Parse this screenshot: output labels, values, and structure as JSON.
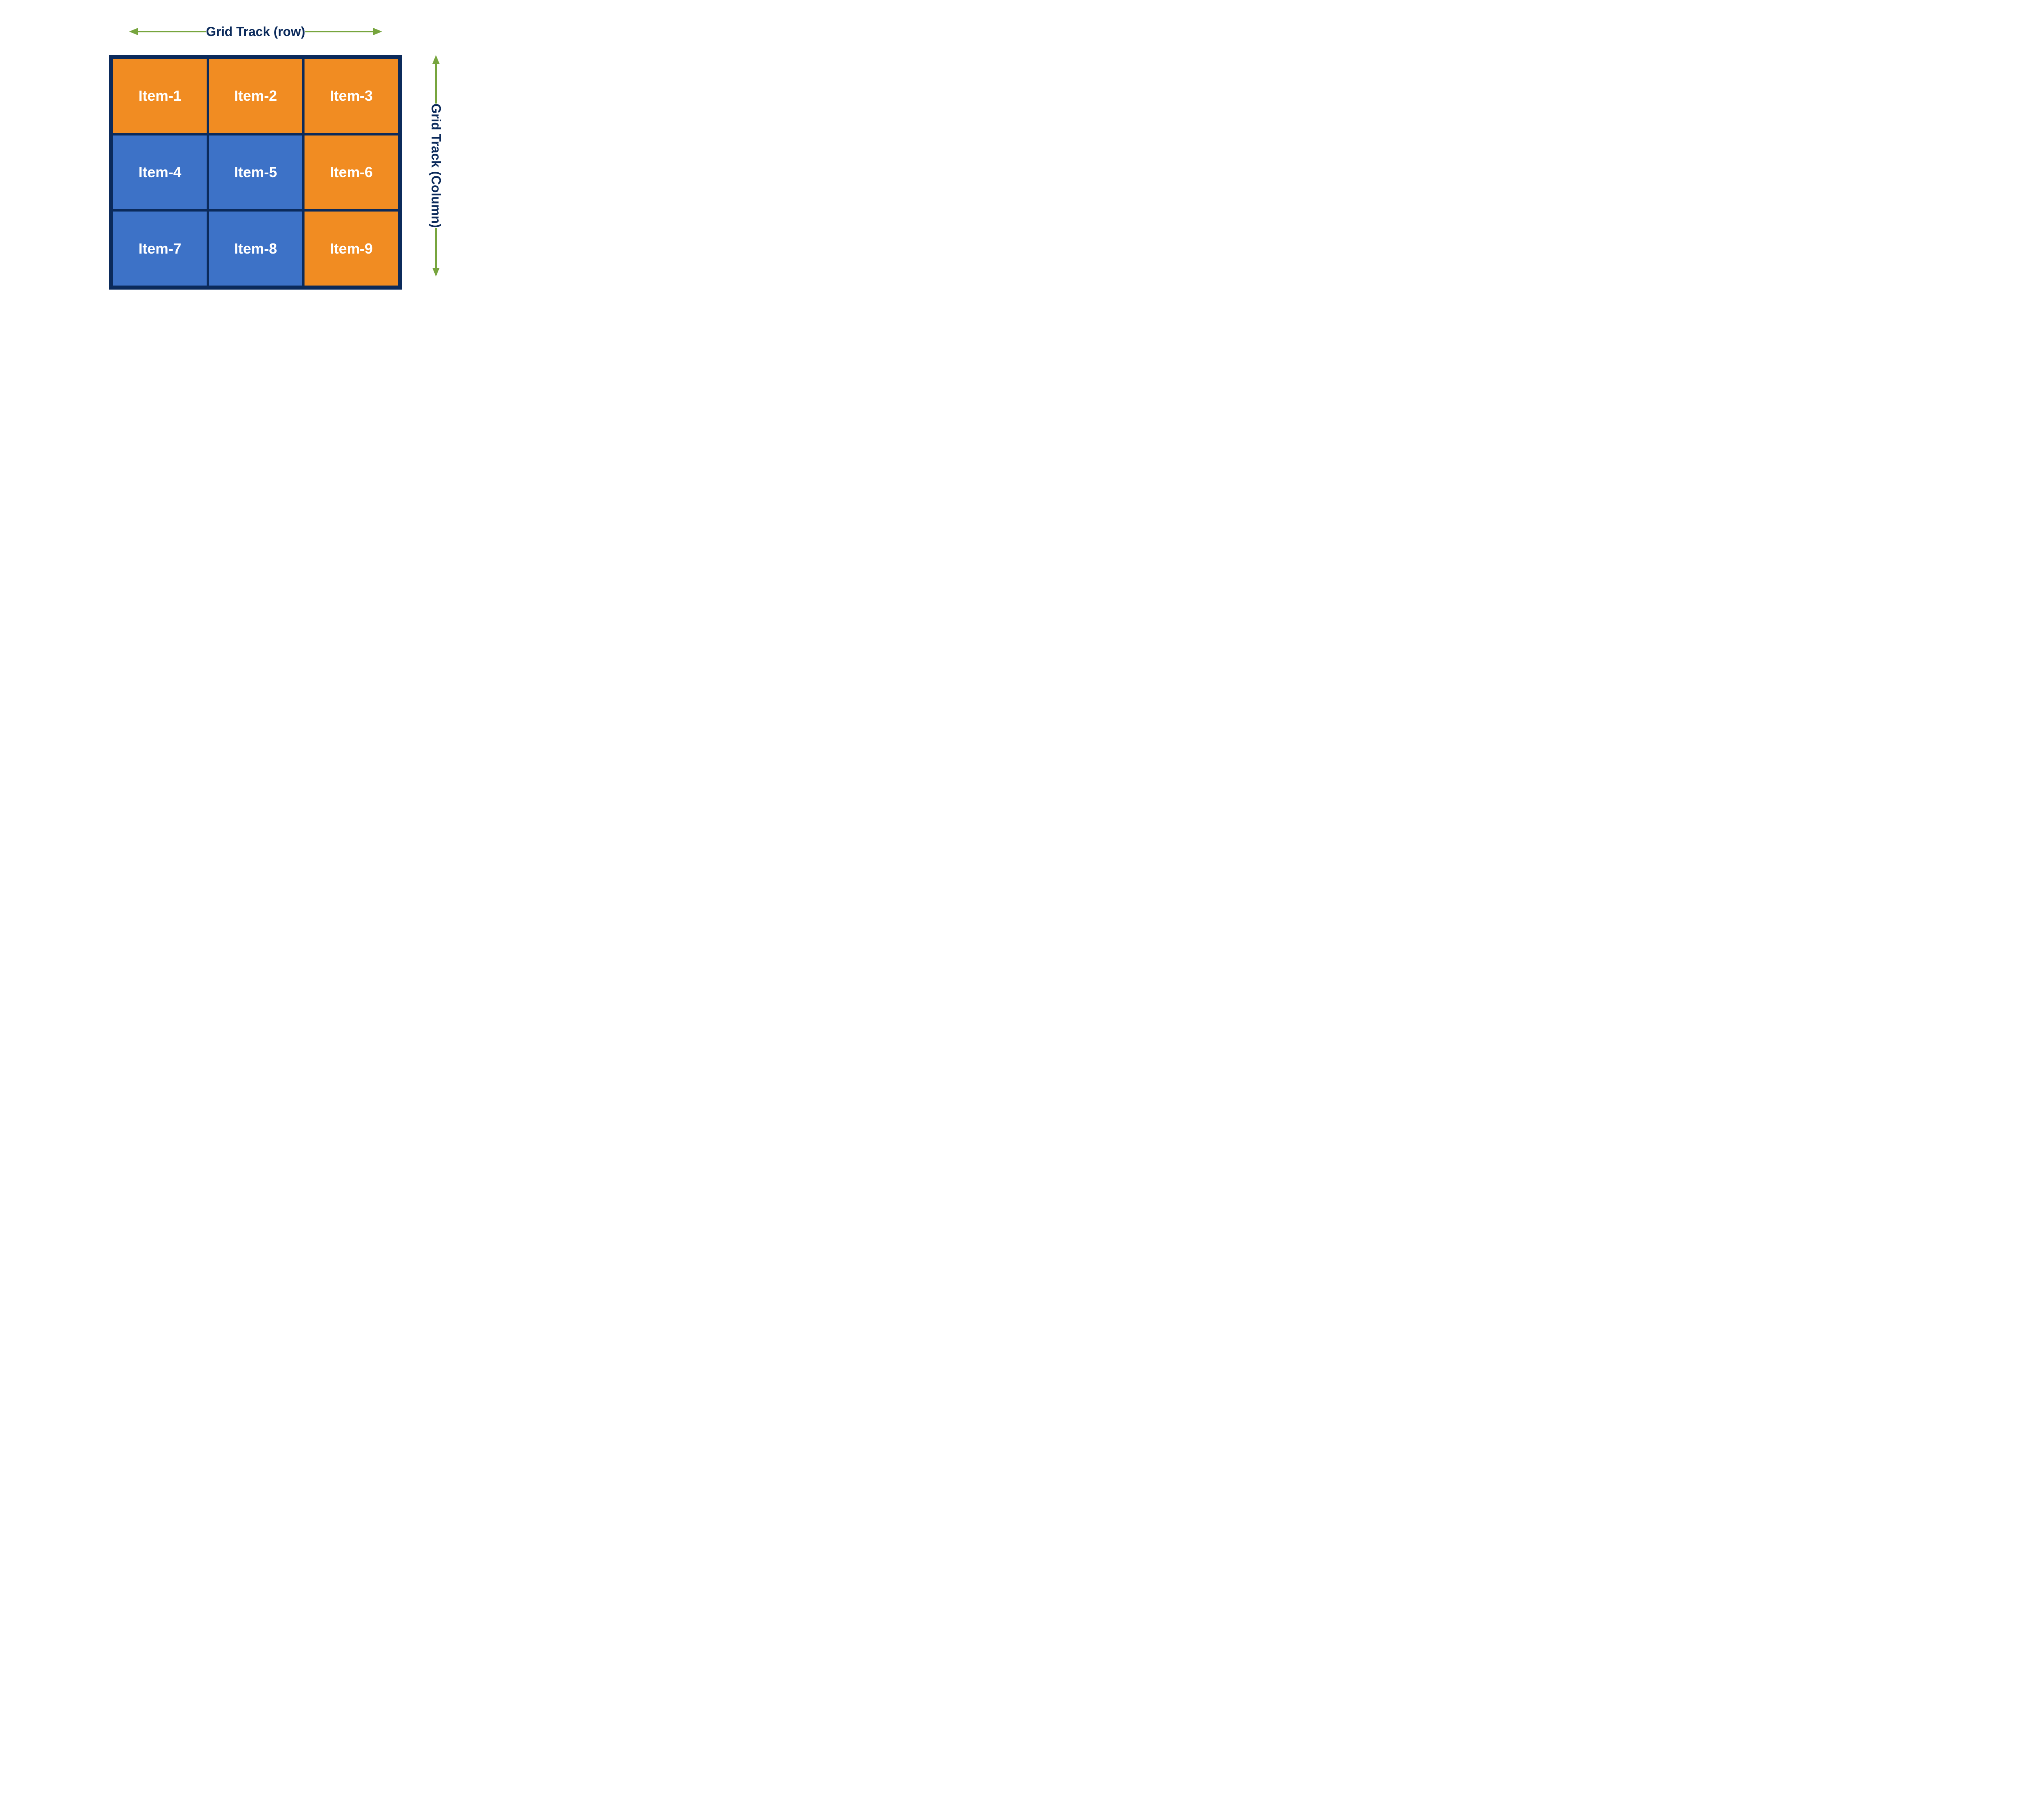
{
  "labels": {
    "row_track": "Grid Track (row)",
    "column_track": "Grid Track (Column)"
  },
  "colors": {
    "navy": "#0b2a5b",
    "orange": "#f18c22",
    "blue": "#3d72c7",
    "arrow": "#77a53e"
  },
  "grid": {
    "rows": 3,
    "cols": 3,
    "cells": [
      {
        "id": 1,
        "label": "Item-1",
        "color": "orange"
      },
      {
        "id": 2,
        "label": "Item-2",
        "color": "orange"
      },
      {
        "id": 3,
        "label": "Item-3",
        "color": "orange"
      },
      {
        "id": 4,
        "label": "Item-4",
        "color": "blue"
      },
      {
        "id": 5,
        "label": "Item-5",
        "color": "blue"
      },
      {
        "id": 6,
        "label": "Item-6",
        "color": "orange"
      },
      {
        "id": 7,
        "label": "Item-7",
        "color": "blue"
      },
      {
        "id": 8,
        "label": "Item-8",
        "color": "blue"
      },
      {
        "id": 9,
        "label": "Item-9",
        "color": "orange"
      }
    ]
  }
}
